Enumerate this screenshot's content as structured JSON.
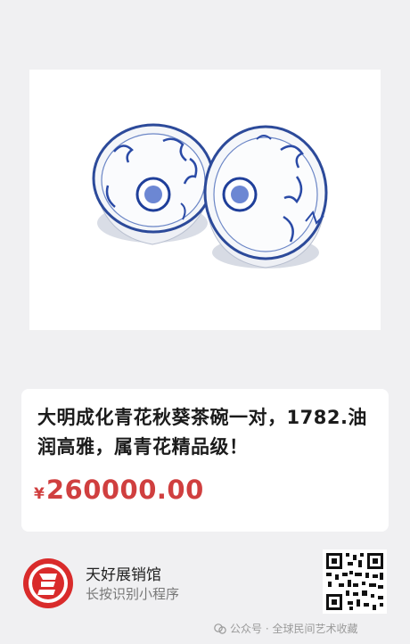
{
  "product": {
    "title": "大明成化青花秋葵茶碗一对，1782.油润高雅，属青花精品级！",
    "price_symbol": "¥",
    "price_value": "260000.00"
  },
  "shop": {
    "name": "天好展销馆",
    "hint": "长按识别小程序",
    "logo_icon": "shop-logo-icon",
    "qr_icon": "miniprogram-qr-code"
  },
  "watermark": {
    "text": "公众号 · 全球民间艺术收藏"
  },
  "colors": {
    "price": "#d03f3f",
    "background": "#f0f0f2",
    "logo_red": "#d92b2b"
  }
}
